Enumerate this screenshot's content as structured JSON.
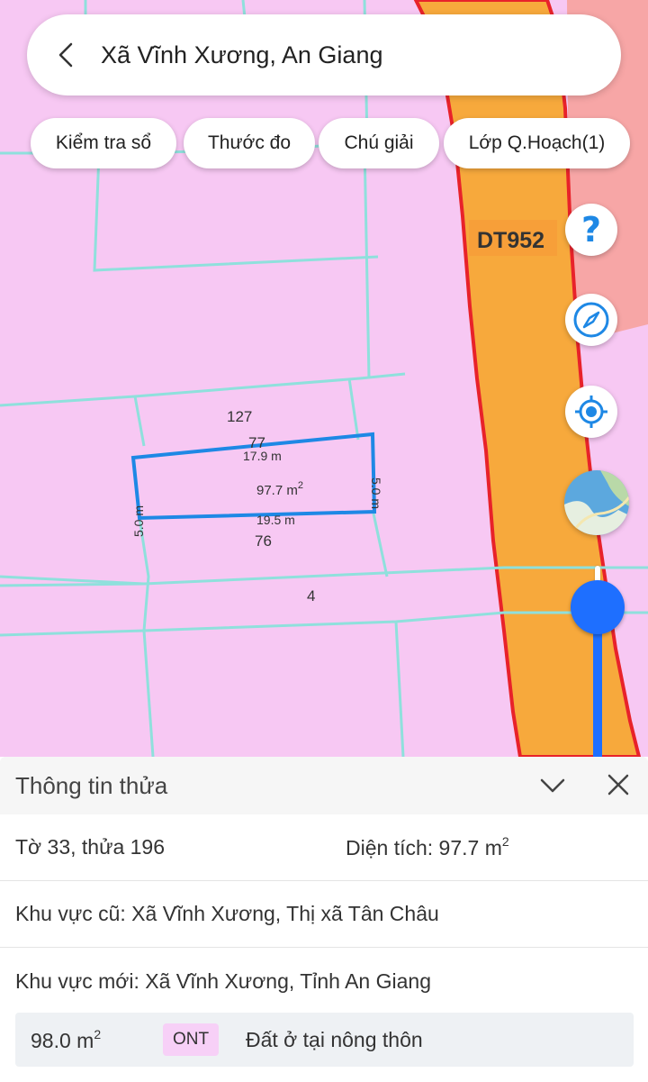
{
  "header": {
    "title": "Xã Vĩnh Xương, An Giang"
  },
  "toolbar": {
    "chips": [
      "Kiểm tra sổ",
      "Thước đo",
      "Chú giải",
      "Lớp Q.Hoạch(1)"
    ]
  },
  "map": {
    "road_label": "DT952",
    "parcel_numbers": {
      "north": "127",
      "selected": "77",
      "south": "76",
      "far_south": "4"
    },
    "selected_parcel": {
      "top_edge": "17.9 m",
      "bottom_edge": "19.5 m",
      "left_edge": "5.0 m",
      "right_edge": "5.0 m",
      "area_value": "97.7 m",
      "area_exp": "2"
    },
    "colors": {
      "residential": "#f7c8f3",
      "road": "#f7a93c",
      "road_border": "#e8222a",
      "parcel_line": "#8fe0dc",
      "selection": "#1e88e5"
    }
  },
  "controls": {
    "help_glyph": "?",
    "zoom_level_fraction": 0.1
  },
  "panel": {
    "title": "Thông tin thửa",
    "sheet_parcel": "Tờ 33, thửa 196",
    "area_label": "Diện tích: 97.7 m",
    "area_exp": "2",
    "old_area": "Khu vực cũ: Xã Vĩnh Xương, Thị xã Tân Châu",
    "new_area": "Khu vực mới: Xã Vĩnh Xương, Tỉnh An Giang",
    "land_use": {
      "area": "98.0 m",
      "area_exp": "2",
      "code": "ONT",
      "name": "Đất ở tại nông thôn"
    }
  }
}
